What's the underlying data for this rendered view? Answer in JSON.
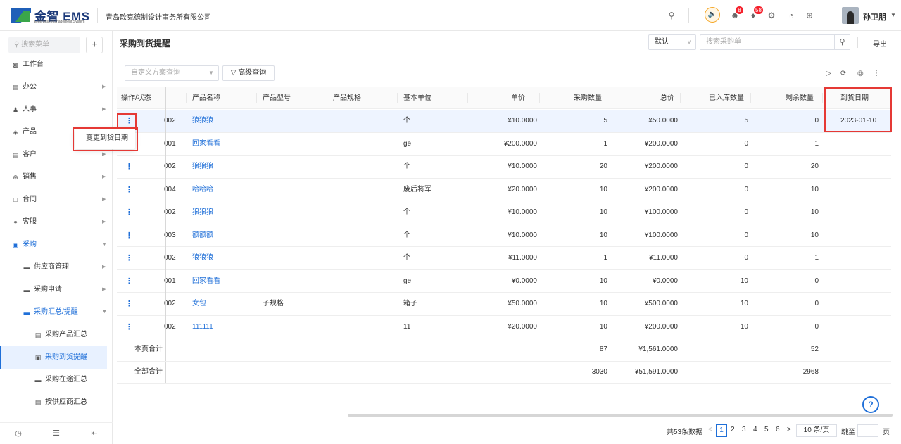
{
  "header": {
    "logo_text": "金智 EMS",
    "logo_sub": "Enterprise Management System",
    "company": "青岛欧克德制设计事务所有限公司",
    "badge_msg": "8",
    "badge_notice": "58",
    "username": "孙卫朋"
  },
  "sidebar": {
    "search_placeholder": "搜索菜单",
    "add": "+",
    "items": [
      {
        "label": "工作台"
      },
      {
        "label": "办公"
      },
      {
        "label": "人事"
      },
      {
        "label": "产品"
      },
      {
        "label": "客户"
      },
      {
        "label": "销售"
      },
      {
        "label": "合同"
      },
      {
        "label": "客服"
      },
      {
        "label": "采购"
      },
      {
        "label": "供应商管理"
      },
      {
        "label": "采购申请"
      },
      {
        "label": "采购汇总/提醒"
      },
      {
        "label": "采购产品汇总"
      },
      {
        "label": "采购到货提醒"
      },
      {
        "label": "采购在途汇总"
      },
      {
        "label": "按供应商汇总"
      }
    ]
  },
  "page": {
    "title": "采购到货提醒",
    "view_select": "默认",
    "search_placeholder": "搜索采购单",
    "export": "导出",
    "scheme_placeholder": "自定义方案查询",
    "advanced": "高级查询"
  },
  "table": {
    "headers": [
      "操作/状态",
      "产品名称",
      "产品型号",
      "产品规格",
      "基本单位",
      "单价",
      "采购数量",
      "总价",
      "已入库数量",
      "剩余数量",
      "到货日期"
    ],
    "rows": [
      {
        "code": "002",
        "name": "狼狼狼",
        "model": "",
        "unit": "个",
        "price": "¥10.0000",
        "qty": "5",
        "total": "¥50.0000",
        "stocked": "5",
        "remain": "0",
        "date": "2023-01-10"
      },
      {
        "code": "001",
        "name": "回家看看",
        "model": "",
        "unit": "ge",
        "price": "¥200.0000",
        "qty": "1",
        "total": "¥200.0000",
        "stocked": "0",
        "remain": "1",
        "date": ""
      },
      {
        "code": "002",
        "name": "狼狼狼",
        "model": "",
        "unit": "个",
        "price": "¥10.0000",
        "qty": "20",
        "total": "¥200.0000",
        "stocked": "0",
        "remain": "20",
        "date": ""
      },
      {
        "code": "004",
        "name": "哈哈哈",
        "model": "",
        "unit": "废后将军",
        "price": "¥20.0000",
        "qty": "10",
        "total": "¥200.0000",
        "stocked": "0",
        "remain": "10",
        "date": ""
      },
      {
        "code": "002",
        "name": "狼狼狼",
        "model": "",
        "unit": "个",
        "price": "¥10.0000",
        "qty": "10",
        "total": "¥100.0000",
        "stocked": "0",
        "remain": "10",
        "date": ""
      },
      {
        "code": "003",
        "name": "额额额",
        "model": "",
        "unit": "个",
        "price": "¥10.0000",
        "qty": "10",
        "total": "¥100.0000",
        "stocked": "0",
        "remain": "10",
        "date": ""
      },
      {
        "code": "002",
        "name": "狼狼狼",
        "model": "",
        "unit": "个",
        "price": "¥11.0000",
        "qty": "1",
        "total": "¥11.0000",
        "stocked": "0",
        "remain": "1",
        "date": ""
      },
      {
        "code": "001",
        "name": "回家看看",
        "model": "",
        "unit": "ge",
        "price": "¥0.0000",
        "qty": "10",
        "total": "¥0.0000",
        "stocked": "10",
        "remain": "0",
        "date": ""
      },
      {
        "code": "002",
        "name": "女包",
        "model": "子规格",
        "unit": "箱子",
        "price": "¥50.0000",
        "qty": "10",
        "total": "¥500.0000",
        "stocked": "10",
        "remain": "0",
        "date": ""
      },
      {
        "code": "002",
        "name": "111111",
        "model": "",
        "unit": "11",
        "price": "¥20.0000",
        "qty": "10",
        "total": "¥200.0000",
        "stocked": "10",
        "remain": "0",
        "date": ""
      }
    ],
    "page_total": {
      "label": "本页合计",
      "qty": "87",
      "total": "¥1,561.0000",
      "remain": "52"
    },
    "all_total": {
      "label": "全部合计",
      "qty": "3030",
      "total": "¥51,591.0000",
      "remain": "2968"
    },
    "row_menu_item": "变更到货日期"
  },
  "pagination": {
    "summary": "共53条数据",
    "prev": "<",
    "pages": [
      "1",
      "2",
      "3",
      "4",
      "5",
      "6"
    ],
    "next": ">",
    "page_size": "10 条/页",
    "jump_label": "跳至",
    "jump_unit": "页"
  },
  "help": "?",
  "colors": {
    "accent": "#1f6fd8",
    "highlight": "#e53935"
  }
}
